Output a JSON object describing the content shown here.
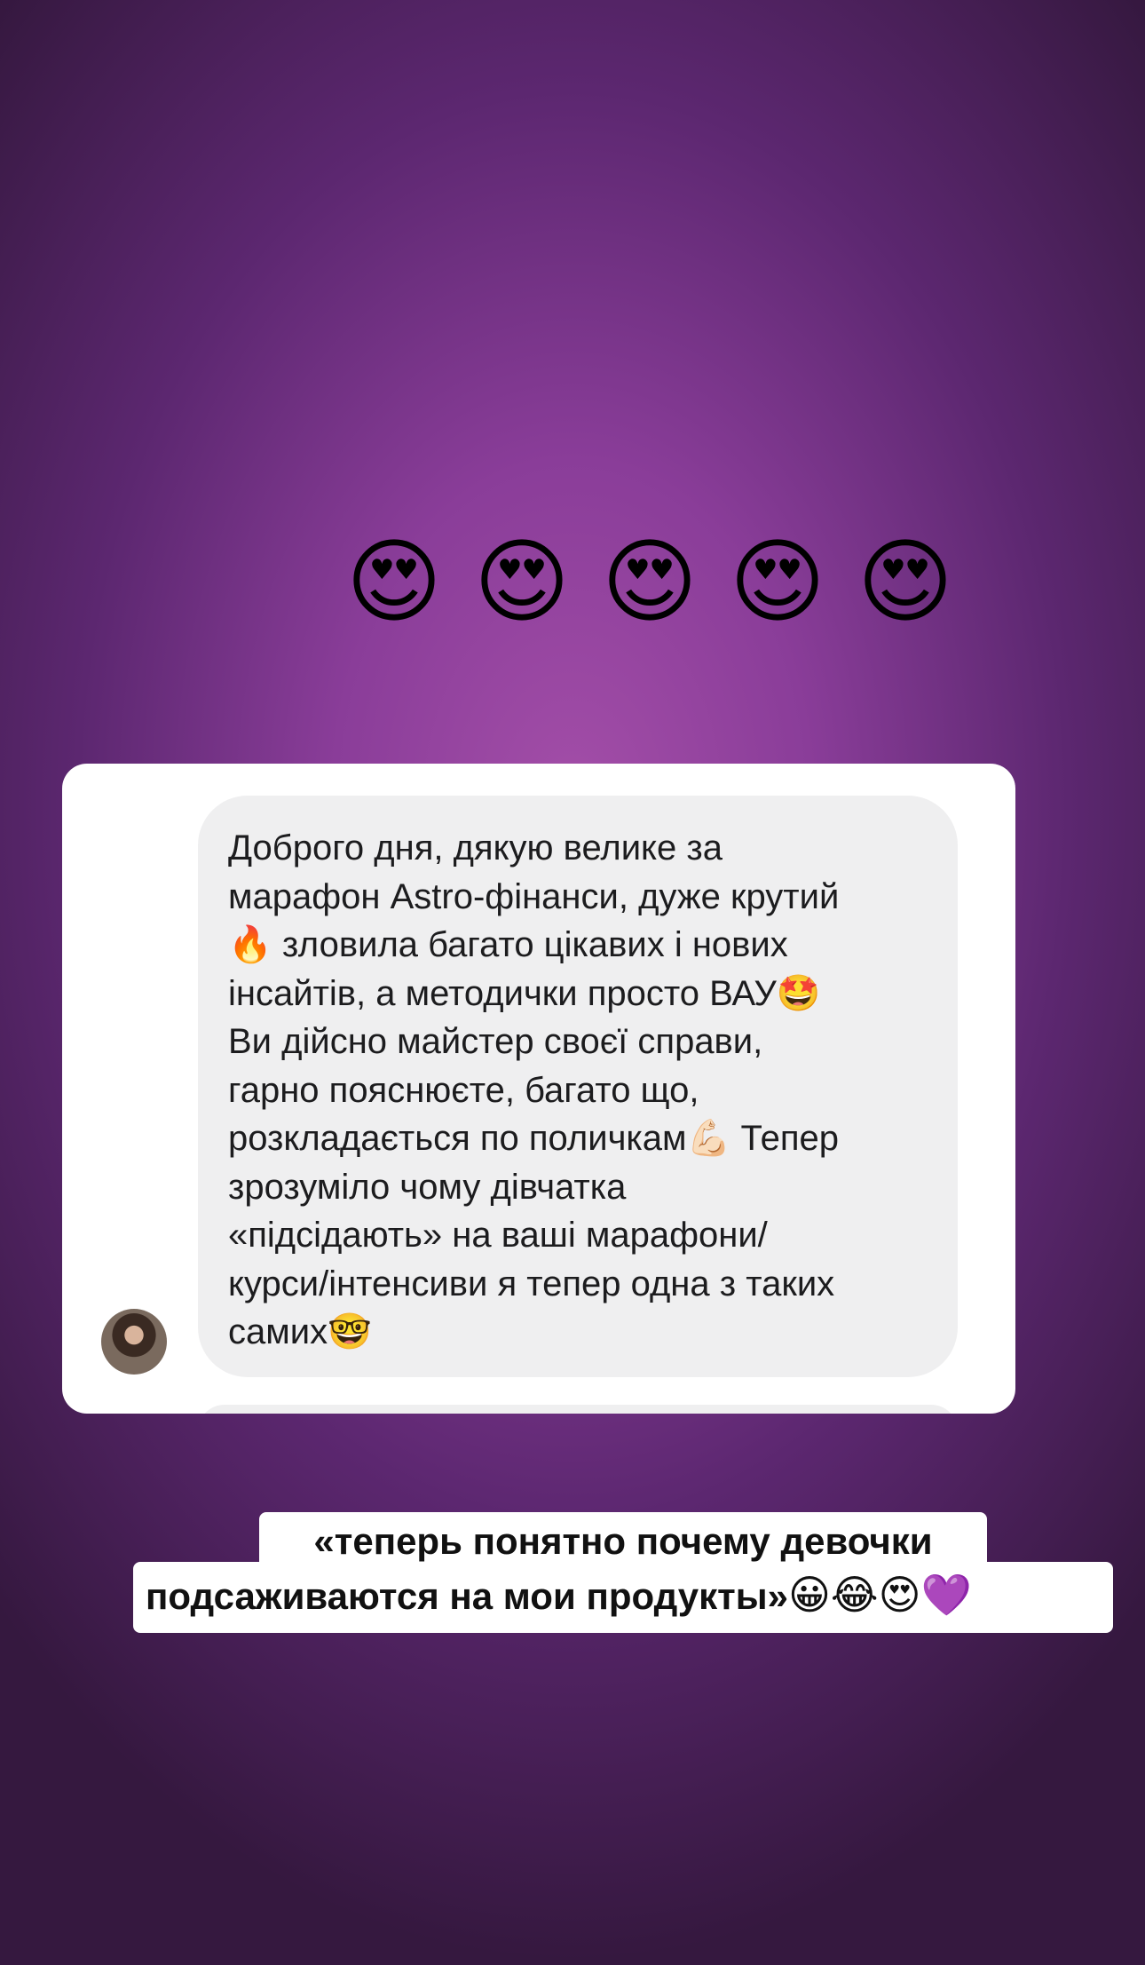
{
  "emojis_top": [
    "😍",
    "😍",
    "😍",
    "😍",
    "😍"
  ],
  "message": {
    "text": "Доброго дня, дякую велике за\nмарафон Astro-фінанси, дуже крутий\n🔥 зловила багато цікавих і нових\nінсайтів, а методички просто ВАУ🤩\nВи дійсно майстер своєї справи,\nгарно пояснюєте, багато що,\nрозкладається по поличкам💪🏻 Тепер\nзрозуміло чому дівчатка\n«підсідають» на ваші марафони/\nкурси/інтенсиви я тепер одна з таких\nсамих🤓"
  },
  "caption": {
    "line1": "«теперь понятно почему девочки",
    "line2": "подсаживаются на мои продукты»",
    "emojis": "😀😂😍💜"
  }
}
